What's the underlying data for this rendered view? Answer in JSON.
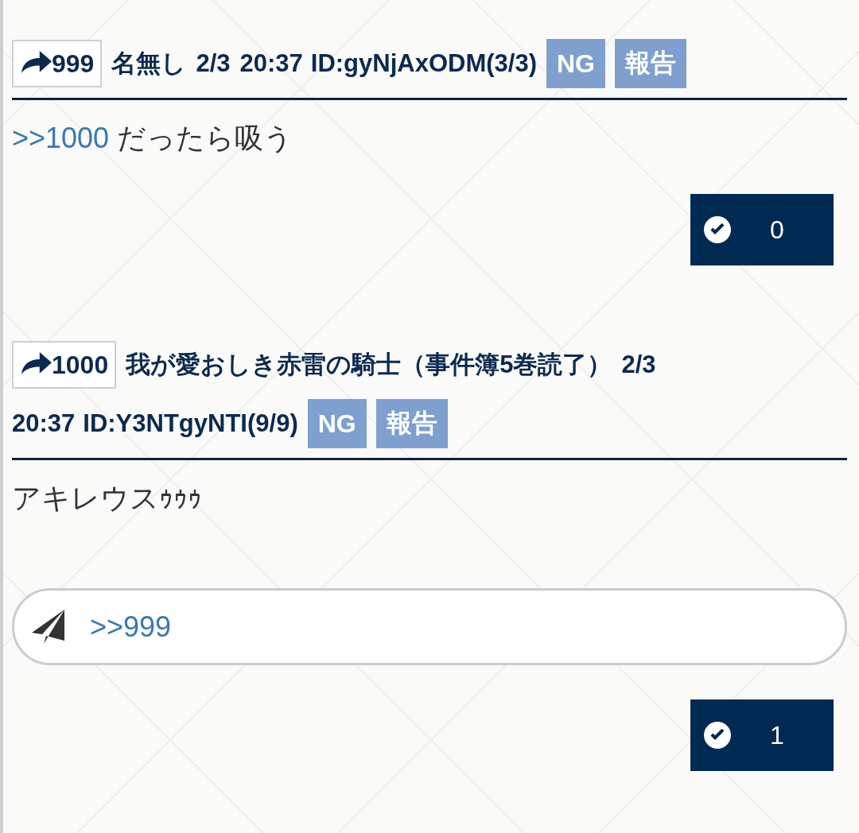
{
  "posts": [
    {
      "number": "999",
      "author": "名無し",
      "date": "2/3",
      "time": "20:37",
      "id": "ID:gyNjAxODM(3/3)",
      "ng_button": "NG",
      "report_button": "報告",
      "body": [
        {
          "kind": "anchor",
          "text": ">>1000"
        },
        {
          "kind": "text",
          "text": "だったら吸う"
        }
      ],
      "likes": "0"
    },
    {
      "number": "1000",
      "author": "我が愛おしき赤雷の騎士（事件簿5巻読了）",
      "date": "2/3",
      "time": "20:37",
      "id": "ID:Y3NTgyNTI(9/9)",
      "ng_button": "NG",
      "report_button": "報告",
      "body": [
        {
          "kind": "text",
          "text": "アキレウスｩｩｩ"
        }
      ],
      "replies": [
        ">>999"
      ],
      "likes": "1"
    }
  ]
}
